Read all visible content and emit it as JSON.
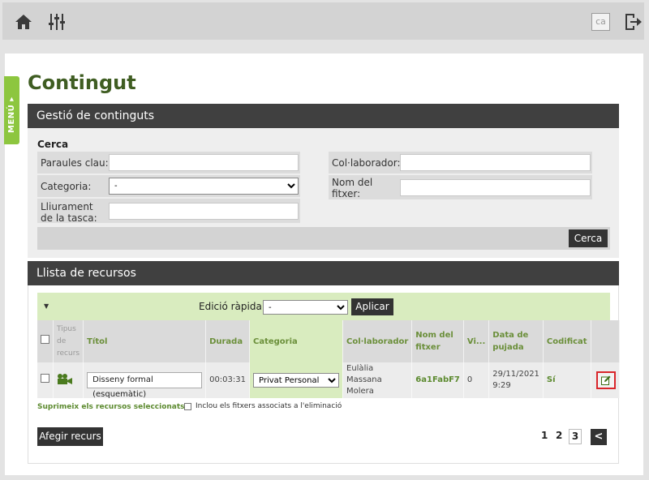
{
  "topbar": {
    "language": "ca"
  },
  "menu_tab": {
    "label": "MENÚ ▸"
  },
  "page": {
    "title": "Contingut"
  },
  "content_management": {
    "header": "Gestió de continguts",
    "search_heading": "Cerca",
    "keywords_label": "Paraules clau:",
    "category_label": "Categoria:",
    "category_value": "-",
    "task_delivery_label": "Lliurament de la tasca:",
    "collaborator_label": "Col·laborador:",
    "filename_label": "Nom del fitxer:",
    "search_button": "Cerca"
  },
  "resource_list": {
    "header": "Llista de recursos",
    "quick_edit_label": "Edició ràpida:",
    "quick_edit_value": "-",
    "apply_button": "Aplicar",
    "columns": [
      "Tipus de recurs",
      "Títol",
      "Durada",
      "Categoria",
      "Col·laborador",
      "Nom del fitxer",
      "Vi...",
      "Data de pujada",
      "Codificat"
    ],
    "rows": [
      {
        "title": "Disseny formal (esquemàtic)",
        "duration": "00:03:31",
        "category": "Privat Personal",
        "collaborator": "Eulàlia Massana Molera",
        "filename": "6a1FabF7",
        "views": "0",
        "upload_date": "29/11/2021 9:29",
        "encoded": "Sí"
      }
    ],
    "delete_selected": "Suprimeix els recursos seleccionats",
    "delete_asterisk": "*",
    "include_files_label": "Inclou els fitxers associats a l'eliminació",
    "add_button": "Afegir recurs"
  },
  "pagination": {
    "pages": [
      "1",
      "2",
      "3"
    ],
    "current": "3",
    "prev_symbol": "<"
  },
  "colors": {
    "brand_green": "#3f5d22",
    "menu_green": "#8dc63f",
    "highlight_green": "#d9ecbf",
    "dark_header": "#404040"
  }
}
